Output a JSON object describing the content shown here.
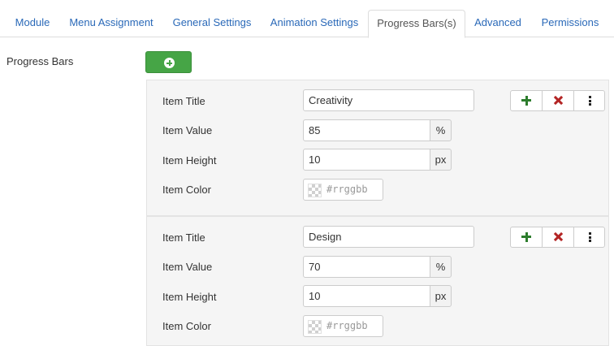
{
  "tabs": [
    {
      "label": "Module",
      "active": false
    },
    {
      "label": "Menu Assignment",
      "active": false
    },
    {
      "label": "General Settings",
      "active": false
    },
    {
      "label": "Animation Settings",
      "active": false
    },
    {
      "label": "Progress Bars(s)",
      "active": true
    },
    {
      "label": "Advanced",
      "active": false
    },
    {
      "label": "Permissions",
      "active": false
    }
  ],
  "section": {
    "label": "Progress Bars",
    "add_icon": "plus-circle-icon"
  },
  "labels": {
    "title": "Item Title",
    "value": "Item Value",
    "height": "Item Height",
    "color": "Item Color"
  },
  "units": {
    "value": "%",
    "height": "px"
  },
  "color_placeholder": "#rrggbb",
  "items": [
    {
      "title": "Creativity",
      "value": "85",
      "height": "10",
      "color": ""
    },
    {
      "title": "Design",
      "value": "70",
      "height": "10",
      "color": ""
    }
  ],
  "action_icons": [
    "plus-icon",
    "x-icon",
    "more-vertical-icon"
  ],
  "colors": {
    "accent_green": "#46a546",
    "link_blue": "#2a69b8",
    "remove_red": "#b32424",
    "panel_bg": "#f5f5f5"
  }
}
